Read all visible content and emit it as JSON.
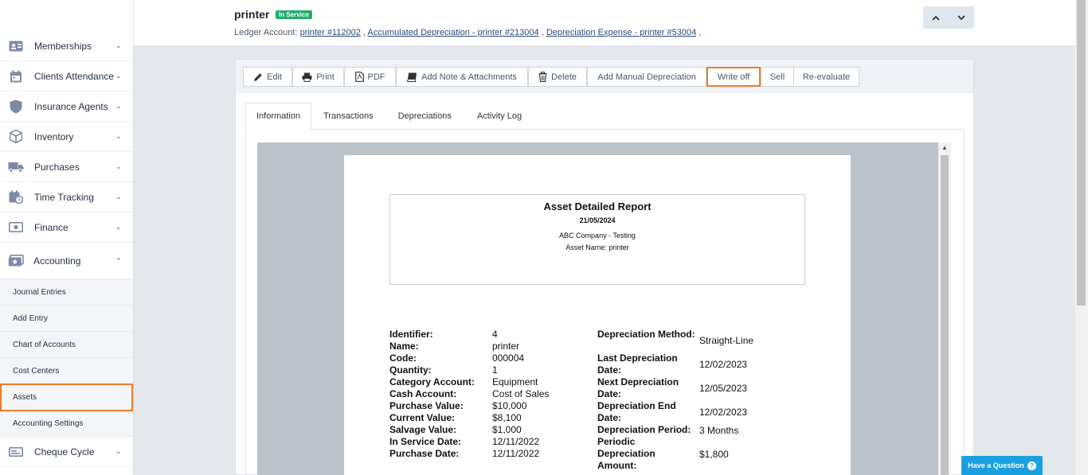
{
  "sidebar": {
    "items": [
      {
        "label": "Memberships",
        "icon": "id-card-icon",
        "chevron": "⌄"
      },
      {
        "label": "Clients Attendance",
        "icon": "calendar-icon",
        "chevron": "⌄"
      },
      {
        "label": "Insurance Agents",
        "icon": "shield-icon",
        "chevron": "⌄"
      },
      {
        "label": "Inventory",
        "icon": "box-icon",
        "chevron": "⌄"
      },
      {
        "label": "Purchases",
        "icon": "truck-icon",
        "chevron": "⌄"
      },
      {
        "label": "Time Tracking",
        "icon": "calendar-clock-icon",
        "chevron": "⌄"
      },
      {
        "label": "Finance",
        "icon": "money-icon",
        "chevron": "⌄"
      },
      {
        "label": "Accounting",
        "icon": "cash-icon",
        "chevron": "⌃"
      }
    ],
    "sub_items": [
      {
        "label": "Journal Entries"
      },
      {
        "label": "Add Entry"
      },
      {
        "label": "Chart of Accounts"
      },
      {
        "label": "Cost Centers"
      },
      {
        "label": "Assets"
      },
      {
        "label": "Accounting Settings"
      }
    ],
    "after": {
      "label": "Cheque Cycle",
      "icon": "cheque-icon",
      "chevron": "⌄"
    }
  },
  "header": {
    "title": "printer",
    "status": "In Service",
    "ledger_label": "Ledger Account:",
    "ledger_links": [
      "printer #112002",
      "Accumulated Depreciation - printer #213004",
      "Depreciation Expense - printer #53004"
    ],
    "sep": ","
  },
  "toolbar": {
    "buttons": [
      {
        "label": "Edit",
        "icon": "pencil-icon"
      },
      {
        "label": "Print",
        "icon": "printer-icon"
      },
      {
        "label": "PDF",
        "icon": "pdf-icon"
      },
      {
        "label": "Add Note & Attachments",
        "icon": "book-icon"
      },
      {
        "label": "Delete",
        "icon": "trash-icon"
      },
      {
        "label": "Add Manual Depreciation"
      },
      {
        "label": "Write off"
      },
      {
        "label": "Sell"
      },
      {
        "label": "Re-evaluate"
      }
    ]
  },
  "tabs": [
    "Information",
    "Transactions",
    "Depreciations",
    "Activity Log"
  ],
  "report": {
    "title": "Asset Detailed Report",
    "date": "21/05/2024",
    "company": "ABC Company - Testing",
    "asset_name": "Asset Name: printer",
    "left_fields": [
      {
        "k": "Identifier:",
        "v": "4"
      },
      {
        "k": "Name:",
        "v": "printer"
      },
      {
        "k": "Code:",
        "v": "000004"
      },
      {
        "k": "Quantity:",
        "v": "1"
      },
      {
        "k": "Category Account:",
        "v": "Equipment"
      },
      {
        "k": "Cash Account:",
        "v": "Cost of Sales"
      },
      {
        "k": "Purchase Value:",
        "v": "$10,000"
      },
      {
        "k": "Current Value:",
        "v": "$8,100"
      },
      {
        "k": "Salvage Value:",
        "v": "$1,000"
      },
      {
        "k": "In Service Date:",
        "v": "12/11/2022"
      },
      {
        "k": "Purchase Date:",
        "v": "12/11/2022"
      }
    ],
    "right_fields": [
      {
        "k": "Depreciation Method:",
        "v": "Straight-Line"
      },
      {
        "k": "Last Depreciation Date:",
        "v": "12/02/2023"
      },
      {
        "k": "Next Depreciation Date:",
        "v": "12/05/2023"
      },
      {
        "k": "Depreciation End Date:",
        "v": "12/02/2023"
      },
      {
        "k": "Depreciation Period:",
        "v": "3 Months"
      },
      {
        "k": "Periodic Depreciation Amount:",
        "v": "$1,800"
      }
    ]
  },
  "help": {
    "label": "Have a Question",
    "q": "?"
  }
}
